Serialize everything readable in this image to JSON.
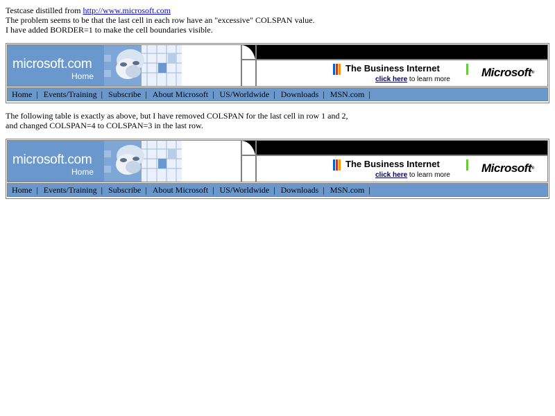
{
  "intro": {
    "line1_prefix": "Testcase distilled from ",
    "line1_link": "http://www.microsoft.com",
    "line2": "The problem seems to be that the last cell in each row have an \"excessive\" COLSPAN value.",
    "line3": "I have added BORDER=1 to make the cell boundaries visible."
  },
  "second_intro": {
    "line1": "The following table is exactly as above, but I have removed COLSPAN for the last cell in row 1 and 2,",
    "line2": "and changed COLSPAN=4 to COLSPAN=3 in the last row."
  },
  "banner": {
    "logo_text": "microsoft.com",
    "logo_home": "Home",
    "ad_title": "The Business Internet",
    "ad_link": "click here",
    "ad_suffix": " to learn more",
    "ms_logo": "Microsoft",
    "ms_logo_mark": "®"
  },
  "nav": {
    "items": [
      "Home",
      "Events/Training",
      "Subscribe",
      "About Microsoft",
      "US/Worldwide",
      "Downloads",
      "MSN.com"
    ],
    "separator": "|"
  },
  "colors": {
    "nav_blue": "#6a98cc",
    "link_blue": "#0000ee",
    "black_bar": "#000000",
    "border_gray": "#808080",
    "ad_bar_colors": [
      "#0066cc",
      "#cc3333",
      "#ff9900",
      "#99cc33"
    ]
  },
  "icons": [
    "photo-icon",
    "curve-corner-icon",
    "color-bars-icon"
  ]
}
